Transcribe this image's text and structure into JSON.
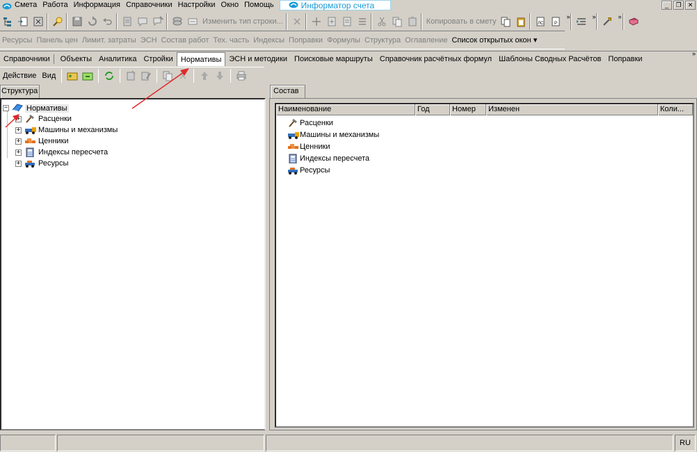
{
  "menubar": {
    "items": [
      "Смета",
      "Работа",
      "Информация",
      "Справочники",
      "Настройки",
      "Окно",
      "Помощь"
    ],
    "informer_tab": "Информатор счета"
  },
  "toolbar1": {
    "change_row_type": "Изменить тип строки...",
    "copy_to_estimate": "Копировать в смету"
  },
  "toolbar2": {
    "items": [
      "Ресурсы",
      "Панель цен",
      "Лимит. затраты",
      "ЭСН",
      "Состав работ",
      "Тех. часть",
      "Индексы",
      "Поправки",
      "Формулы",
      "Структура",
      "Оглавление"
    ],
    "open_windows": "Список открытых окон"
  },
  "tabs": {
    "items": [
      "Справочники",
      "Объекты",
      "Аналитика",
      "Стройки",
      "Нормативы",
      "ЭСН и методики",
      "Поисковые маршруты",
      "Справочник расчётных формул",
      "Шаблоны Сводных Расчётов",
      "Поправки"
    ],
    "active": "Нормативы"
  },
  "actionbar": {
    "action": "Действие",
    "view": "Вид"
  },
  "left_panel": {
    "tab": "Структура",
    "root": "Нормативы",
    "children": [
      {
        "label": "Расценки",
        "icon": "hammer-icon"
      },
      {
        "label": "Машины и механизмы",
        "icon": "truck-icon"
      },
      {
        "label": "Ценники",
        "icon": "price-tag-icon"
      },
      {
        "label": "Индексы пересчета",
        "icon": "calculator-icon"
      },
      {
        "label": "Ресурсы",
        "icon": "resources-icon"
      }
    ]
  },
  "right_panel": {
    "tab": "Состав",
    "columns": [
      "Наименование",
      "Год",
      "Номер",
      "Изменен",
      "Коли..."
    ],
    "rows": [
      {
        "label": "Расценки",
        "icon": "hammer-icon"
      },
      {
        "label": "Машины и механизмы",
        "icon": "truck-icon"
      },
      {
        "label": "Ценники",
        "icon": "price-tag-icon"
      },
      {
        "label": "Индексы пересчета",
        "icon": "calculator-icon"
      },
      {
        "label": "Ресурсы",
        "icon": "resources-icon"
      }
    ]
  },
  "statusbar": {
    "lang": "RU"
  },
  "colors": {
    "annotation_arrow": "#e0282b",
    "informer_text": "#1a9ad6",
    "panel_bg": "#d4d0c8"
  }
}
